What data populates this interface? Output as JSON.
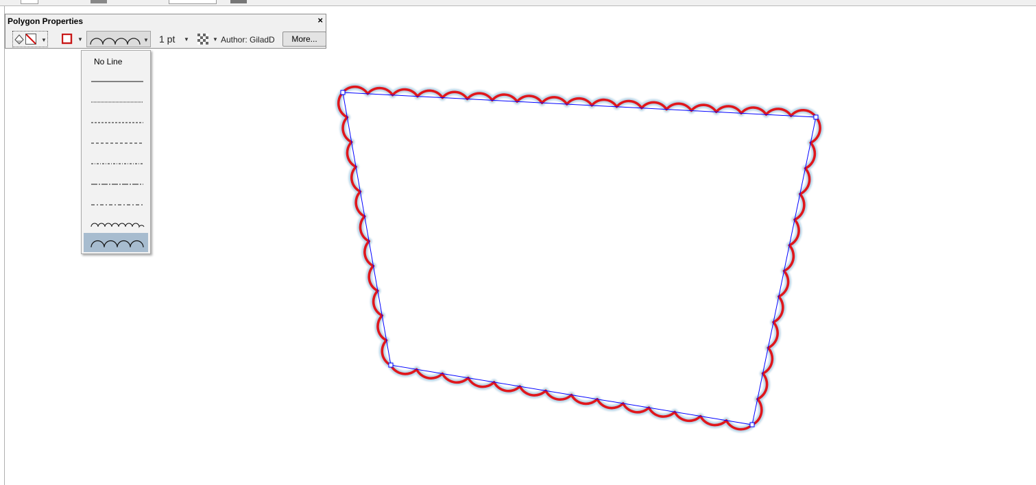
{
  "panel": {
    "title": "Polygon Properties",
    "close_label": "×",
    "line_width": "1 pt",
    "author_label": "Author:",
    "author_name": "GiladD",
    "more_label": "More..."
  },
  "line_styles": {
    "no_line_label": "No Line",
    "selected_index": 9
  },
  "colors": {
    "stroke": "#e0171c",
    "selection": "#0000ff",
    "highlight": "#a7bccf"
  }
}
